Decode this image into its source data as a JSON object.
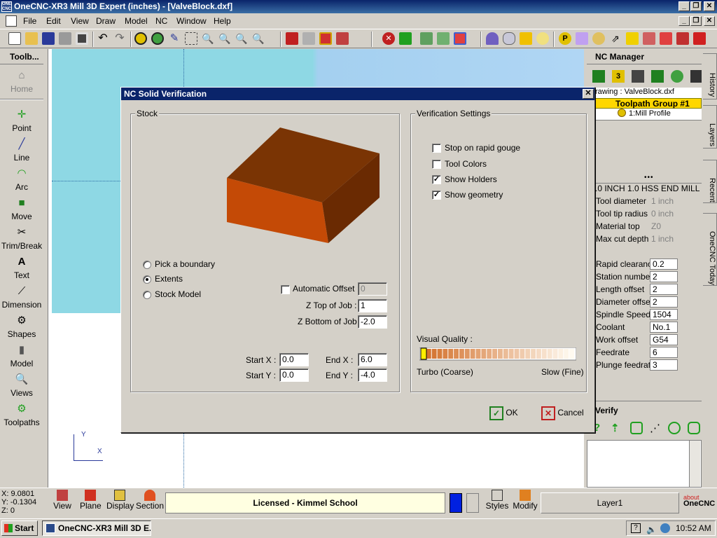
{
  "app": {
    "title": "OneCNC-XR3 Mill 3D Expert (inches) - [ValveBlock.dxf]",
    "icon_text": "ONE CNC"
  },
  "menu": [
    {
      "label": "File"
    },
    {
      "label": "Edit"
    },
    {
      "label": "View"
    },
    {
      "label": "Draw"
    },
    {
      "label": "Model"
    },
    {
      "label": "NC"
    },
    {
      "label": "Window"
    },
    {
      "label": "Help"
    }
  ],
  "left_toolbar": {
    "header": "Toolb...",
    "items": [
      {
        "label": "Home",
        "icon": "house-icon"
      },
      {
        "label": "Point",
        "icon": "point-icon"
      },
      {
        "label": "Line",
        "icon": "line-icon"
      },
      {
        "label": "Arc",
        "icon": "arc-icon"
      },
      {
        "label": "Move",
        "icon": "move-icon"
      },
      {
        "label": "Trim/Break",
        "icon": "scissors-icon"
      },
      {
        "label": "Text",
        "icon": "text-icon"
      },
      {
        "label": "Dimension",
        "icon": "dimension-icon"
      },
      {
        "label": "Shapes",
        "icon": "shapes-icon"
      },
      {
        "label": "Model",
        "icon": "model-icon"
      },
      {
        "label": "Views",
        "icon": "views-icon"
      },
      {
        "label": "Toolpaths",
        "icon": "toolpaths-icon"
      }
    ]
  },
  "nc_manager": {
    "header": "NC Manager",
    "drawing": "rawing : ValveBlock.dxf",
    "group": "Toolpath Group #1",
    "operation": "1:Mill Profile",
    "tool_name": ".0 INCH 1.0 HSS END MILL",
    "info": [
      {
        "label": "Tool diameter",
        "value": "1 inch"
      },
      {
        "label": "Tool tip radius",
        "value": "0 inch"
      },
      {
        "label": "Material top",
        "value": "Z0"
      },
      {
        "label": "Max cut depth",
        "value": "1 inch"
      }
    ],
    "params": [
      {
        "label": "Rapid clearanc",
        "value": "0.2"
      },
      {
        "label": "Station number",
        "value": "2"
      },
      {
        "label": "Length offset",
        "value": "2"
      },
      {
        "label": "Diameter offset",
        "value": "2"
      },
      {
        "label": "Spindle Speed",
        "value": "1504"
      },
      {
        "label": "Coolant",
        "value": "No.1"
      },
      {
        "label": "Work offset",
        "value": "G54"
      },
      {
        "label": "Feedrate",
        "value": "6"
      },
      {
        "label": "Plunge feedrate",
        "value": "3"
      }
    ],
    "verify_header": "Verify"
  },
  "right_tabs": [
    {
      "label": "History"
    },
    {
      "label": "Layers"
    },
    {
      "label": "Recent"
    },
    {
      "label": "OneCNC Today"
    }
  ],
  "dialog": {
    "title": "NC Solid Verification",
    "stock_group": "Stock",
    "stock_options": [
      {
        "label": "Pick a boundary",
        "selected": false
      },
      {
        "label": "Extents",
        "selected": true
      },
      {
        "label": "Stock Model",
        "selected": false
      }
    ],
    "auto_offset_label": "Automatic Offset :",
    "auto_offset_value": "0",
    "z_top_label": "Z Top of Job :",
    "z_top_value": "1",
    "z_bottom_label": "Z Bottom of Job :",
    "z_bottom_value": "-2.0",
    "start_x_label": "Start X :",
    "start_x_value": "0.0",
    "start_y_label": "Start Y :",
    "start_y_value": "0.0",
    "end_x_label": "End X :",
    "end_x_value": "6.0",
    "end_y_label": "End Y :",
    "end_y_value": "-4.0",
    "verify_group": "Verification Settings",
    "checkboxes": [
      {
        "label": "Stop on rapid gouge",
        "checked": false
      },
      {
        "label": "Tool Colors",
        "checked": false
      },
      {
        "label": "Show Holders",
        "checked": true
      },
      {
        "label": "Show geometry",
        "checked": true
      }
    ],
    "quality_label": "Visual Quality :",
    "quality_min": "Turbo (Coarse)",
    "quality_max": "Slow (Fine)",
    "quality_level": 0,
    "ok_label": "OK",
    "cancel_label": "Cancel",
    "stock_color": "#c04a0a"
  },
  "status": {
    "coord_x": "X: 9.0801",
    "coord_y": "Y: -0.1304",
    "coord_z": "Z: 0",
    "view_buttons": [
      {
        "label": "View"
      },
      {
        "label": "Plane"
      },
      {
        "label": "Display"
      },
      {
        "label": "Section"
      }
    ],
    "license": "Licensed - Kimmel School",
    "styles_label": "Styles",
    "modify_label": "Modify",
    "layer": "Layer1",
    "about_top": "about",
    "about_brand": "OneCNC"
  },
  "taskbar": {
    "start": "Start",
    "task": "OneCNC-XR3 Mill 3D E...",
    "clock": "10:52 AM"
  }
}
